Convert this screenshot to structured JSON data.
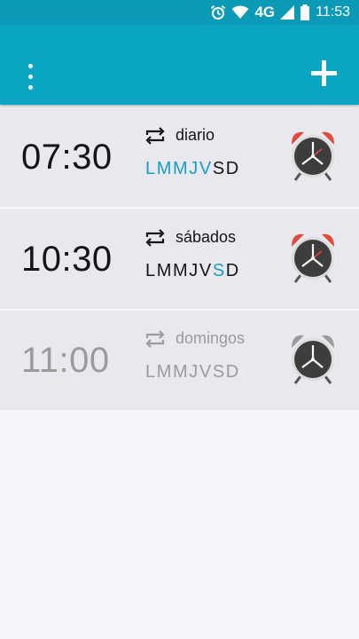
{
  "status_bar": {
    "network": "4G",
    "time": "11:53"
  },
  "toolbar": {
    "menu_icon": "more-vert-icon",
    "add_icon": "plus-icon"
  },
  "colors": {
    "toolbar": "#0ba5c4",
    "active_day": "#1a9dc2",
    "bell_enabled": "#e24a3b",
    "bell_disabled": "#9b9b9b"
  },
  "alarms": [
    {
      "time": "07:30",
      "repeat_label": "diario",
      "enabled": true,
      "days": [
        {
          "letter": "L",
          "on": true
        },
        {
          "letter": "M",
          "on": true
        },
        {
          "letter": "M",
          "on": true
        },
        {
          "letter": "J",
          "on": true
        },
        {
          "letter": "V",
          "on": true
        },
        {
          "letter": "S",
          "on": false
        },
        {
          "letter": "D",
          "on": false
        }
      ]
    },
    {
      "time": "10:30",
      "repeat_label": "sábados",
      "enabled": true,
      "days": [
        {
          "letter": "L",
          "on": false
        },
        {
          "letter": "M",
          "on": false
        },
        {
          "letter": "M",
          "on": false
        },
        {
          "letter": "J",
          "on": false
        },
        {
          "letter": "V",
          "on": false
        },
        {
          "letter": "S",
          "on": true
        },
        {
          "letter": "D",
          "on": false
        }
      ]
    },
    {
      "time": "11:00",
      "repeat_label": "domingos",
      "enabled": false,
      "days": [
        {
          "letter": "L",
          "on": false
        },
        {
          "letter": "M",
          "on": false
        },
        {
          "letter": "M",
          "on": false
        },
        {
          "letter": "J",
          "on": false
        },
        {
          "letter": "V",
          "on": false
        },
        {
          "letter": "S",
          "on": false
        },
        {
          "letter": "D",
          "on": false
        }
      ]
    }
  ]
}
